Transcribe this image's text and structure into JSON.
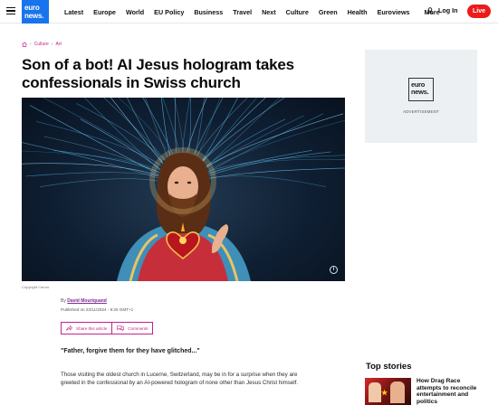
{
  "header": {
    "logo_line1": "euro",
    "logo_line2": "news.",
    "nav": [
      "Latest",
      "Europe",
      "World",
      "EU Policy",
      "Business",
      "Travel",
      "Next",
      "Culture",
      "Green",
      "Health",
      "Euroviews"
    ],
    "more_label": "More",
    "login_label": "Log In",
    "live_label": "Live"
  },
  "breadcrumb": [
    "Culture",
    "Art"
  ],
  "article": {
    "title": "Son of a bot! AI Jesus hologram takes confessionals in Swiss church",
    "copyright": "Copyright Canva",
    "by_prefix": "By",
    "author": "David Mouriquand",
    "published": "Published on 23/11/2024 - 9:25 GMT+1",
    "share_label": "Share this article",
    "comments_label": "Comments",
    "quote": "\"Father, forgive them for they have glitched...\"",
    "body": "Those visiting the oldest church in Lucerne, Switzerland, may be in for a surprise when they are greeted in the confessional by an AI-powered hologram of none other than Jesus Christ himself."
  },
  "ad": {
    "logo_line1": "euro",
    "logo_line2": "news.",
    "label": "ADVERTISEMENT"
  },
  "top_stories": {
    "heading": "Top stories",
    "items": [
      {
        "title": "How Drag Race attempts to reconcile entertainment and politics"
      }
    ]
  },
  "colors": {
    "brand_blue": "#1874ec",
    "live_red": "#ec1b1b",
    "accent_magenta": "#c4218b"
  }
}
